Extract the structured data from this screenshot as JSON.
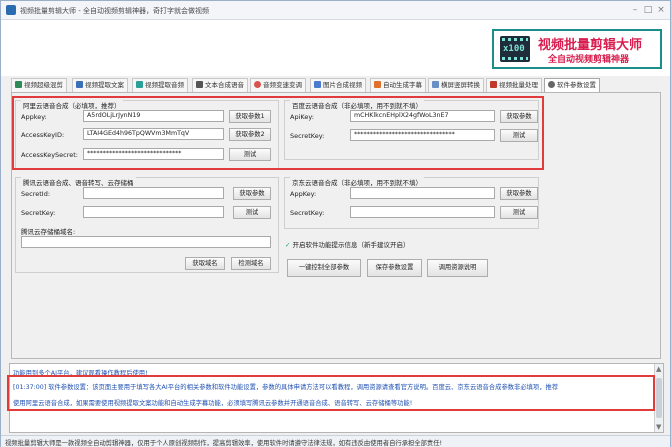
{
  "window": {
    "title": "视频批量剪辑大师 - 全自动视频剪辑神器，奇打字就会做视频",
    "controls": [
      "–",
      "□",
      "×"
    ]
  },
  "logo": {
    "film_text": "x100",
    "main": "视频批量剪辑大师",
    "sub": "全自动视频剪辑神器"
  },
  "tabs": [
    {
      "label": "视频超级混剪",
      "icon": "scissors-icon",
      "color": "#2e8b57"
    },
    {
      "label": "视频提取文案",
      "icon": "document-icon",
      "color": "#3b6fb6"
    },
    {
      "label": "视频提取音频",
      "icon": "audio-icon",
      "color": "#2aa198"
    },
    {
      "label": "文本合成语音",
      "icon": "microphone-icon",
      "color": "#555555"
    },
    {
      "label": "音频变速变调",
      "icon": "speed-icon",
      "color": "#d9534f"
    },
    {
      "label": "图片合成视频",
      "icon": "image-icon",
      "color": "#4a7bd0"
    },
    {
      "label": "自动生成字幕",
      "icon": "subtitle-icon",
      "color": "#e0712c"
    },
    {
      "label": "横屏竖屏转换",
      "icon": "rotate-icon",
      "color": "#6a8fc7"
    },
    {
      "label": "视频批量处理",
      "icon": "batch-icon",
      "color": "#c0392b"
    },
    {
      "label": "软件参数设置",
      "icon": "gear-icon",
      "color": "#666666",
      "active": true
    }
  ],
  "aliyun": {
    "title": "阿里云语音合成（必填项，推荐）",
    "appkey_label": "Appkey:",
    "appkey_value": "A5rdOLjLrJynN19",
    "appkey_btn": "获取参数1",
    "akid_label": "AccessKeyID:",
    "akid_value": "LTAI4GEd4h96TpQWVm3MmTqV",
    "akid_btn": "获取参数2",
    "aksecret_label": "AccessKeySecret:",
    "aksecret_value": "******************************",
    "test_btn": "测试"
  },
  "baidu": {
    "title": "百度云语音合成（非必填项，用不到就不填）",
    "apikey_label": "ApiKey:",
    "apikey_value": "mCHKlkcnEHplX24gfWoL3nE7",
    "get_btn": "获取参数",
    "secret_label": "SecretKey:",
    "secret_value": "********************************",
    "test_btn": "测试"
  },
  "tencent": {
    "title": "腾讯云语音合成、语音转写、云存储桶",
    "secretid_label": "SecretId:",
    "secretid_value": "",
    "get_btn": "获取参数",
    "secretkey_label": "SecretKey:",
    "secretkey_value": "",
    "test_btn": "测试",
    "bucket_label": "腾讯云存储桶域名:",
    "bucket_value": "",
    "get_domain_btn": "获取域名",
    "check_domain_btn": "检测域名"
  },
  "jd": {
    "title": "京东云语音合成（非必填项，用不到就不填）",
    "appkey_label": "AppKey:",
    "appkey_value": "",
    "get_btn": "获取参数",
    "secret_label": "SecretKey:",
    "secret_value": "",
    "test_btn": "测试"
  },
  "options": {
    "tips_checkbox": "开启软件功能提示信息（新手建议开启）",
    "clear_btn": "一键控制全部参数",
    "save_btn": "保存参数设置",
    "help_btn": "调用资源说明"
  },
  "log": {
    "line1": "功能用到多个AI平台，建议观看操作教程后使用!",
    "line2": "[01:37:00] 软件参数设置：该页面主要用于填写各大AI平台的相关参数和软件功能设置，参数的具体申请方法可以看教程，调用资源请查看官方说明。百度云、京东云语音合成参数非必填项，推荐",
    "line3": "使用阿里云语音合成，如果需要使用视频提取文案功能和自动生成字幕功能，必须填写腾讯云参数并开通语音合成、语音转写、云存储桶等功能!"
  },
  "status": {
    "text": "视频批量剪辑大师是一款视频全自动剪辑神器，仅用于个人原创视频制作，提高剪辑效率，使用软件时请遵守法律法规，如有违反由使用者自行承担全部责任!"
  }
}
